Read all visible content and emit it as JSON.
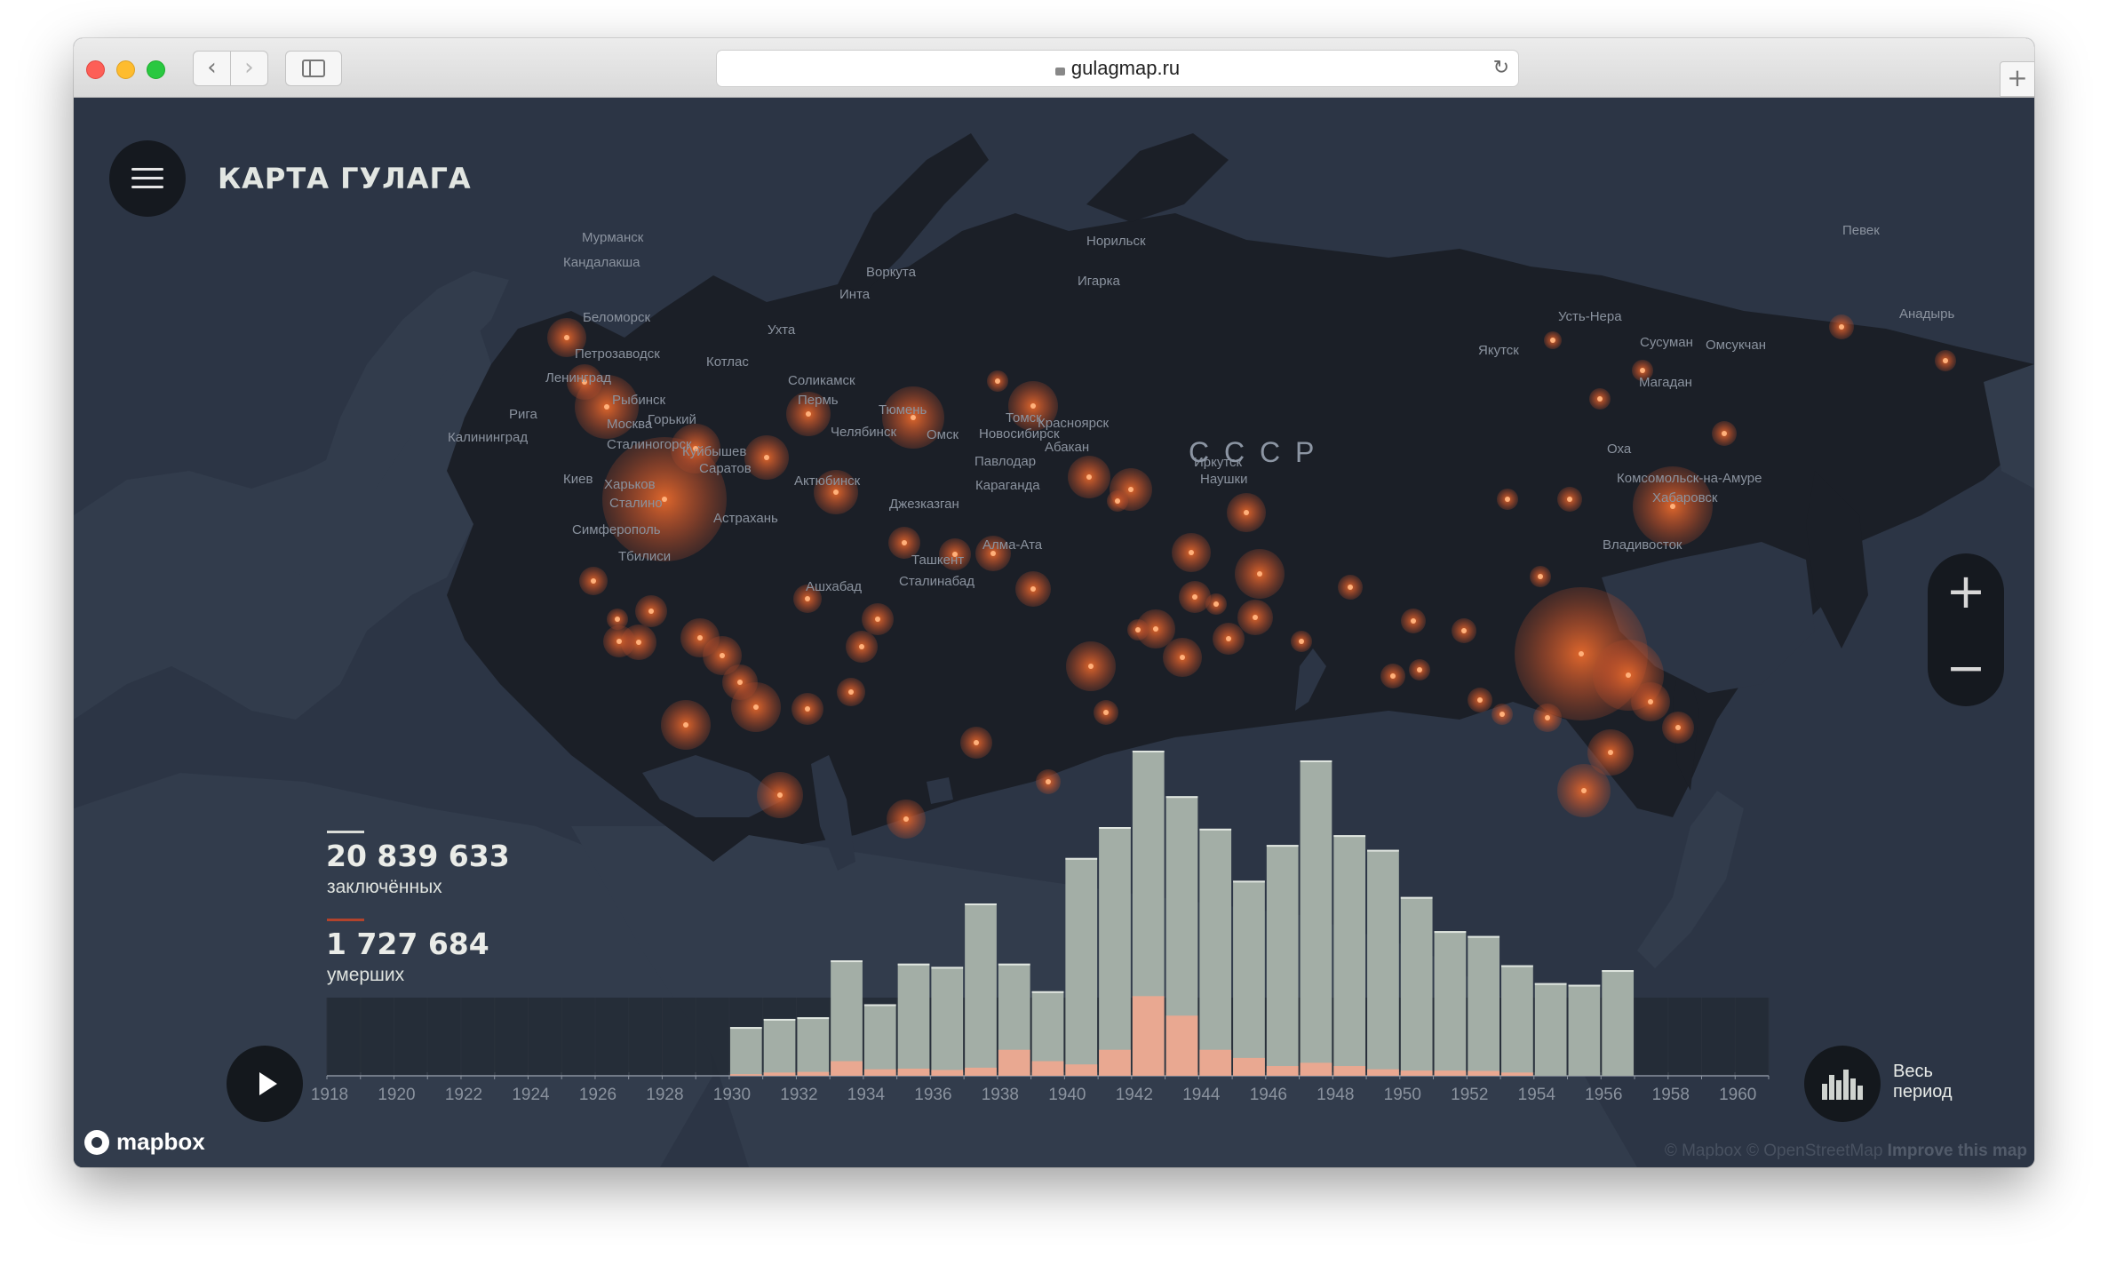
{
  "browser": {
    "url": "gulagmap.ru"
  },
  "app": {
    "title": "КАРТА ГУЛАГА",
    "country_label": "С С С Р"
  },
  "stats": {
    "prisoners_value": "20 839 633",
    "prisoners_label": "заключённых",
    "deaths_value": "1 727 684",
    "deaths_label": "умерших",
    "prisoners_color": "#d9dcd8",
    "deaths_color": "#b2432c"
  },
  "controls": {
    "play_icon": "play-icon",
    "zoom_in": "+",
    "zoom_out": "−",
    "period_label_line1": "Весь",
    "period_label_line2": "период"
  },
  "map": {
    "cities": [
      "Мурманск",
      "Кандалакша",
      "Воркута",
      "Инта",
      "Норильск",
      "Игарка",
      "Певек",
      "Анадырь",
      "Ухта",
      "Беломорск",
      "Петрозаводск",
      "Котлас",
      "Ленинград",
      "Соликамск",
      "Пермь",
      "Рыбинск",
      "Тюмень",
      "Рига",
      "Горький",
      "Челябинск",
      "Калининград",
      "Москва",
      "Сталиногорск",
      "Куйбышев",
      "Омск",
      "Новосибирск",
      "Томск",
      "Красноярск",
      "Абакан",
      "Иркутск",
      "Наушки",
      "Якутск",
      "Усть-Нера",
      "Сусуман",
      "Омсукчан",
      "Магадан",
      "Оха",
      "Комсомольск-на-Амуре",
      "Хабаровск",
      "Владивосток",
      "Павлодар",
      "Караганда",
      "Актюбинск",
      "Джезказган",
      "Саратов",
      "Киев",
      "Харьков",
      "Сталино",
      "Астрахань",
      "Симферополь",
      "Тбилиси",
      "Алма-Ата",
      "Ташкент",
      "Сталинабад",
      "Ашхабад"
    ]
  },
  "attribution": {
    "logo": "mapbox",
    "text": "© Mapbox © OpenStreetMap",
    "improve": "Improve this map"
  },
  "chart_data": {
    "type": "bar",
    "x_ticks": [
      "1918",
      "1920",
      "1922",
      "1924",
      "1926",
      "1928",
      "1930",
      "1932",
      "1934",
      "1936",
      "1938",
      "1940",
      "1942",
      "1944",
      "1946",
      "1948",
      "1950",
      "1952",
      "1954",
      "1956",
      "1958",
      "1960"
    ],
    "categories": [
      1930,
      1931,
      1932,
      1933,
      1934,
      1935,
      1936,
      1937,
      1938,
      1939,
      1940,
      1941,
      1942,
      1943,
      1944,
      1945,
      1946,
      1947,
      1948,
      1949,
      1950,
      1951,
      1952,
      1953,
      1954,
      1955,
      1956
    ],
    "xlim": [
      1918,
      1961
    ],
    "series": [
      {
        "values": [
          0.15,
          0.175,
          0.18,
          0.355,
          0.22,
          0.345,
          0.335,
          0.53,
          0.345,
          0.26,
          0.67,
          0.765,
          1.0,
          0.86,
          0.76,
          0.6,
          0.71,
          0.97,
          0.74,
          0.695,
          0.55,
          0.445,
          0.43,
          0.34,
          0.285,
          0.28,
          0.325
        ],
        "color": "#a3aea6"
      },
      {
        "values": [
          0.005,
          0.01,
          0.012,
          0.045,
          0.02,
          0.022,
          0.018,
          0.025,
          0.08,
          0.045,
          0.035,
          0.08,
          0.245,
          0.185,
          0.08,
          0.055,
          0.03,
          0.04,
          0.03,
          0.02,
          0.016,
          0.016,
          0.015,
          0.01,
          0.0,
          0.0,
          0.0
        ],
        "color": "#e9a891"
      }
    ],
    "ylim": [
      0,
      1.0
    ]
  }
}
